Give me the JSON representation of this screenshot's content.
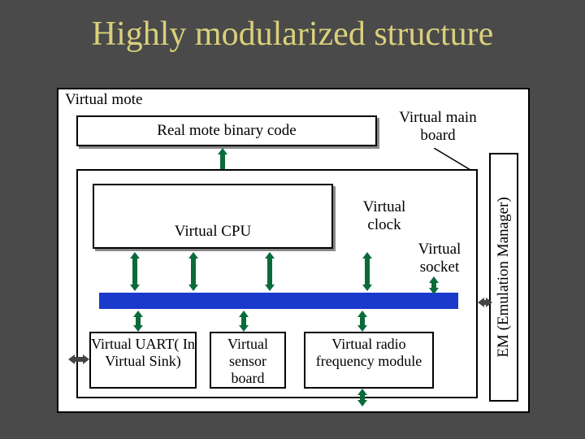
{
  "title": "Highly modularized structure",
  "outer": {
    "label": "Virtual  mote"
  },
  "binary": {
    "label": "Real mote binary code"
  },
  "mainboard": {
    "label": "Virtual\nmain board"
  },
  "cpu": {
    "label": "Virtual CPU"
  },
  "clock": {
    "label": "Virtual\nclock"
  },
  "socket": {
    "label": "Virtual\nsocket"
  },
  "uart": {
    "label": "Virtual UART(\nIn Virtual\nSink)"
  },
  "sensor": {
    "label": "Virtual\nsensor\nboard"
  },
  "radio": {
    "label": "Virtual radio\nfrequency\nmodule"
  },
  "em": {
    "label": "EM (Emulation Manager)"
  }
}
